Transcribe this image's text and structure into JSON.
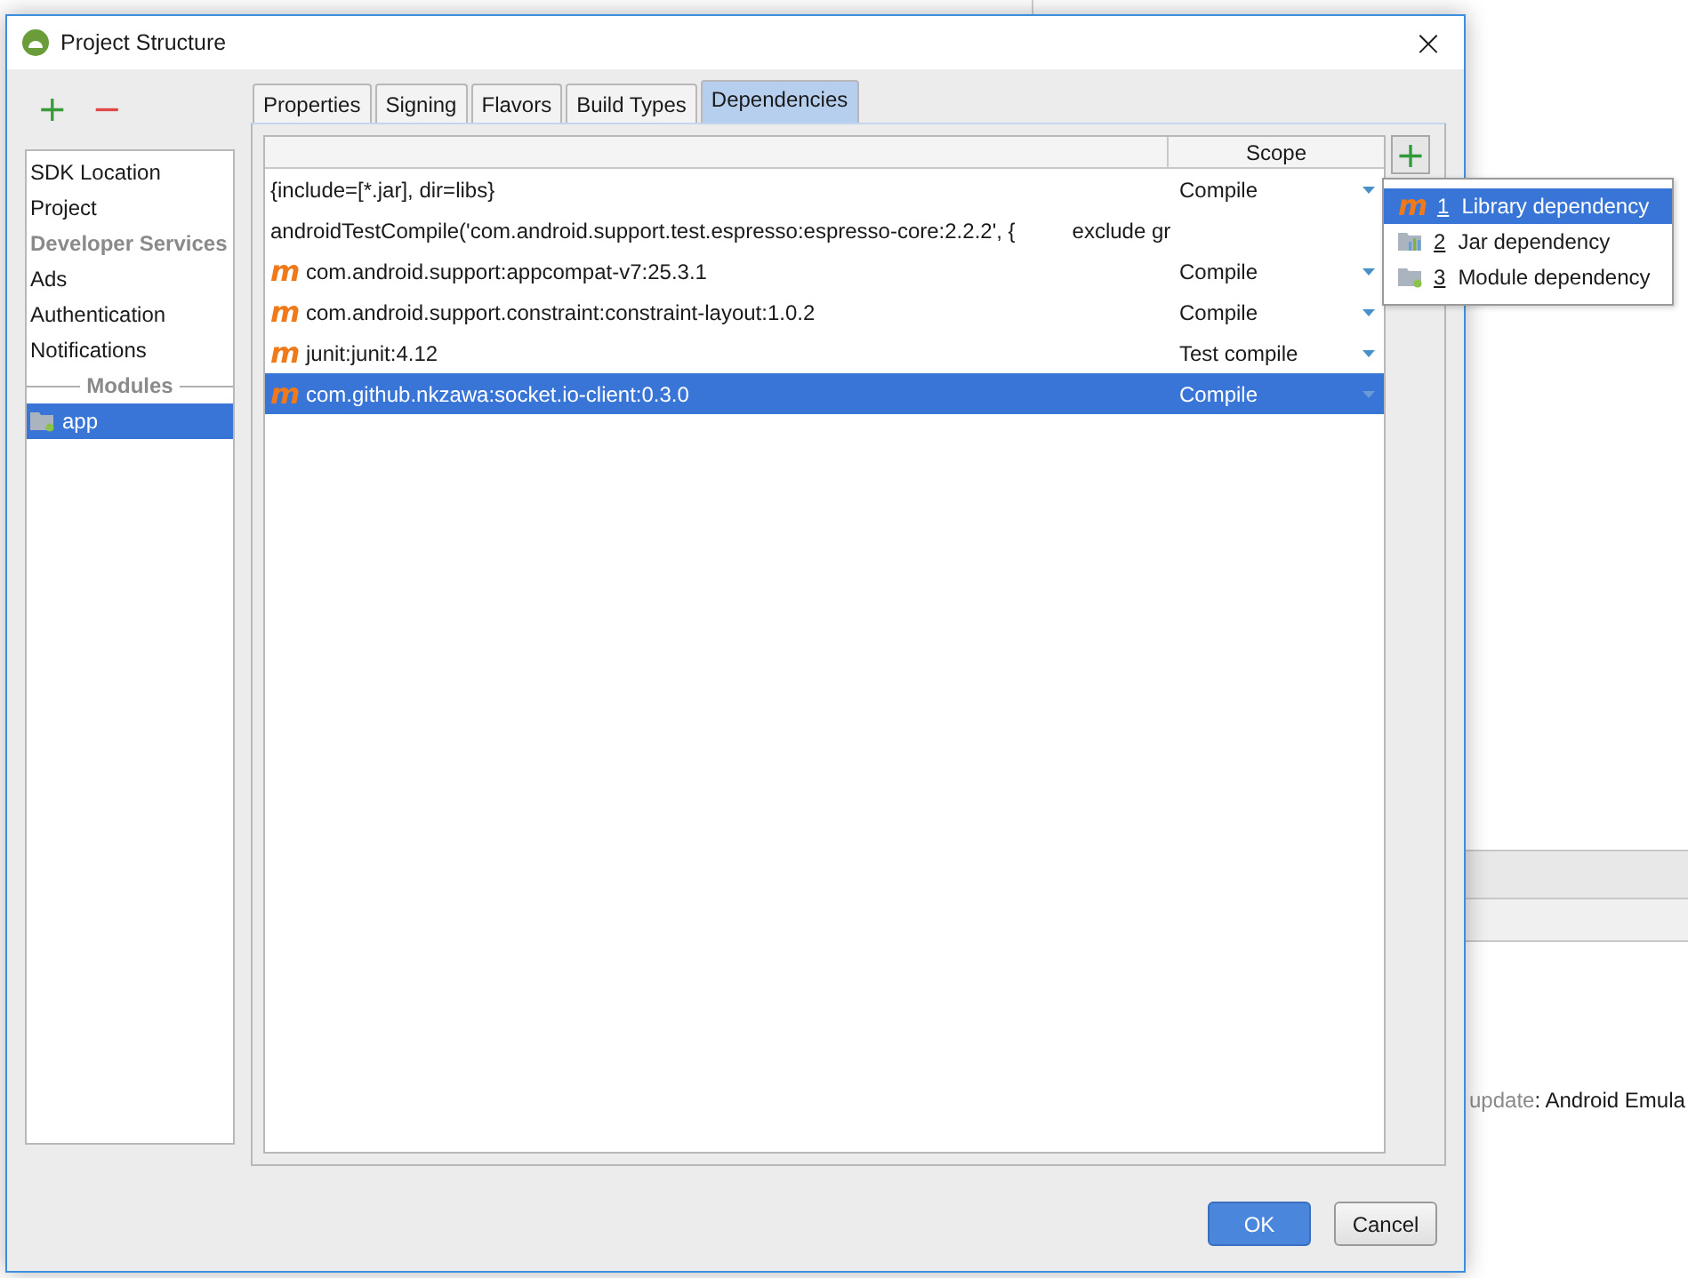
{
  "background": {
    "notice_label": "update",
    "notice_text": ": Android Emula"
  },
  "window": {
    "title": "Project Structure",
    "close": "×"
  },
  "toolbar": {
    "add": "+",
    "remove": "−"
  },
  "sidebar": {
    "items": [
      {
        "label": "SDK Location",
        "kind": "item",
        "selected": false
      },
      {
        "label": "Project",
        "kind": "item",
        "selected": false
      },
      {
        "label": "Developer Services",
        "kind": "header"
      },
      {
        "label": "Ads",
        "kind": "item",
        "selected": false
      },
      {
        "label": "Authentication",
        "kind": "item",
        "selected": false
      },
      {
        "label": "Notifications",
        "kind": "item",
        "selected": false
      },
      {
        "label": "Modules",
        "kind": "separator"
      },
      {
        "label": "app",
        "kind": "module",
        "selected": true
      }
    ]
  },
  "tabs": [
    {
      "label": "Properties",
      "selected": false
    },
    {
      "label": "Signing",
      "selected": false
    },
    {
      "label": "Flavors",
      "selected": false
    },
    {
      "label": "Build Types",
      "selected": false
    },
    {
      "label": "Dependencies",
      "selected": true
    }
  ],
  "table": {
    "columns": [
      "Scope"
    ],
    "rows": [
      {
        "kind": "file",
        "name": "{include=[*.jar], dir=libs}",
        "scope": "Compile",
        "selected": false
      },
      {
        "kind": "raw",
        "name": "androidTestCompile('com.android.support.test.espresso:espresso-core:2.2.2', {",
        "extra": "exclude gr",
        "selected": false
      },
      {
        "kind": "library",
        "icon": "m",
        "name": "com.android.support:appcompat-v7:25.3.1",
        "scope": "Compile",
        "selected": false
      },
      {
        "kind": "library",
        "icon": "m",
        "name": "com.android.support.constraint:constraint-layout:1.0.2",
        "scope": "Compile",
        "selected": false
      },
      {
        "kind": "library",
        "icon": "m",
        "name": "junit:junit:4.12",
        "scope": "Test compile",
        "selected": false
      },
      {
        "kind": "library",
        "icon": "m",
        "name": "com.github.nkzawa:socket.io-client:0.3.0",
        "scope": "Compile",
        "selected": true
      }
    ]
  },
  "add_button": "+",
  "add_menu": [
    {
      "kind": "library",
      "icon": "m",
      "number": "1",
      "label": "Library dependency",
      "selected": true
    },
    {
      "kind": "jar",
      "number": "2",
      "label": "Jar dependency",
      "selected": false
    },
    {
      "kind": "module",
      "number": "3",
      "label": "Module dependency",
      "selected": false
    }
  ],
  "buttons": [
    {
      "label": "OK",
      "kind": "primary"
    },
    {
      "label": "Cancel",
      "kind": "normal"
    }
  ]
}
